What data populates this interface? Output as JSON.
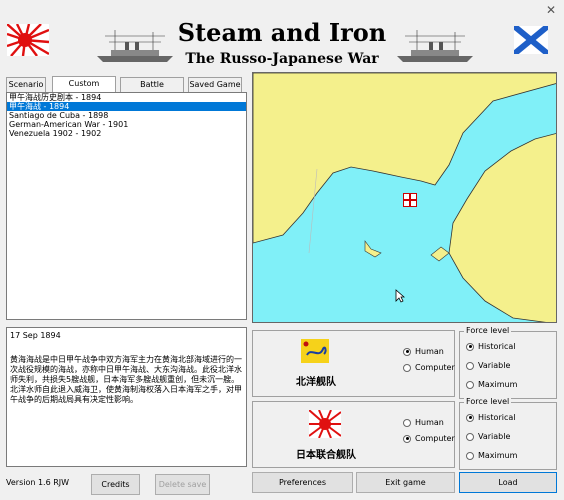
{
  "window": {
    "close_glyph": "✕"
  },
  "header": {
    "title": "Steam and Iron",
    "subtitle": "The Russo-Japanese War"
  },
  "tabs": [
    {
      "label": "Scenario"
    },
    {
      "label": "Custom Scenario"
    },
    {
      "label": "Battle Generator"
    },
    {
      "label": "Saved Game"
    }
  ],
  "scenarios": [
    {
      "label": "甲午海战历史剧本 - 1894",
      "selected": false
    },
    {
      "label": "甲午海战 - 1894",
      "selected": true
    },
    {
      "label": "Santiago de Cuba - 1898",
      "selected": false
    },
    {
      "label": "German-American War - 1901",
      "selected": false
    },
    {
      "label": "Venezuela 1902 - 1902",
      "selected": false
    }
  ],
  "description": {
    "date": "17 Sep 1894",
    "body": "黄海海战是中日甲午战争中双方海军主力在黄海北部海域进行的一次战役规模的海战，亦称中日甲午海战、大东沟海战。此役北洋水师失利，共损失5艘战舰，日本海军多艘战舰重创，但未沉一艘。北洋水师自此退入威海卫，使黄海制海权落入日本海军之手，对甲午战争的后期战局具有决定性影响。"
  },
  "sides": [
    {
      "name": "北洋舰队",
      "flag_icon": "qing-dragon-flag-icon",
      "control_options": [
        "Human",
        "Computer"
      ],
      "control_selected": "Human",
      "force_level_title": "Force level",
      "force_levels": [
        "Historical",
        "Variable",
        "Maximum"
      ],
      "force_selected": "Historical"
    },
    {
      "name": "日本联合舰队",
      "flag_icon": "rising-sun-flag-icon",
      "control_options": [
        "Human",
        "Computer"
      ],
      "control_selected": "Computer",
      "force_level_title": "Force level",
      "force_levels": [
        "Historical",
        "Variable",
        "Maximum"
      ],
      "force_selected": "Historical"
    }
  ],
  "footer": {
    "version": "Version 1.6 RJW",
    "credits": "Credits",
    "delete_save": "Delete save",
    "preferences": "Preferences",
    "exit_game": "Exit game",
    "load": "Load"
  },
  "colors": {
    "sea": "#80f0f8",
    "land": "#f4f08c",
    "selection": "#0078d7"
  }
}
